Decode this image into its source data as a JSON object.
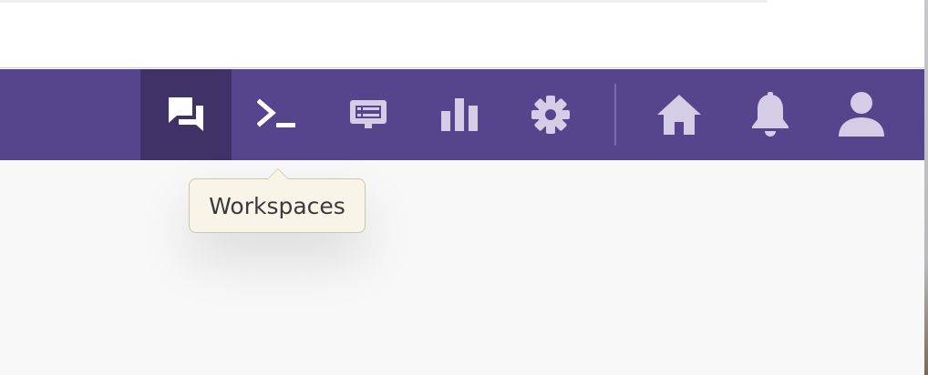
{
  "navbar": {
    "left_items": [
      {
        "icon": "chat-icon",
        "active": true
      },
      {
        "icon": "terminal-icon",
        "active": false
      },
      {
        "icon": "presentation-icon",
        "active": false
      },
      {
        "icon": "bar-chart-icon",
        "active": false
      },
      {
        "icon": "gear-icon",
        "active": false
      }
    ],
    "right_items": [
      {
        "icon": "home-icon"
      },
      {
        "icon": "bell-icon"
      },
      {
        "icon": "user-icon"
      }
    ]
  },
  "tooltip": {
    "text": "Workspaces"
  },
  "colors": {
    "navbar_bg": "#55458c",
    "navbar_active_bg": "#3f3266",
    "icon_active": "#ffffff",
    "icon_inactive": "#d4cde6",
    "tooltip_bg": "#f8f5e8"
  }
}
